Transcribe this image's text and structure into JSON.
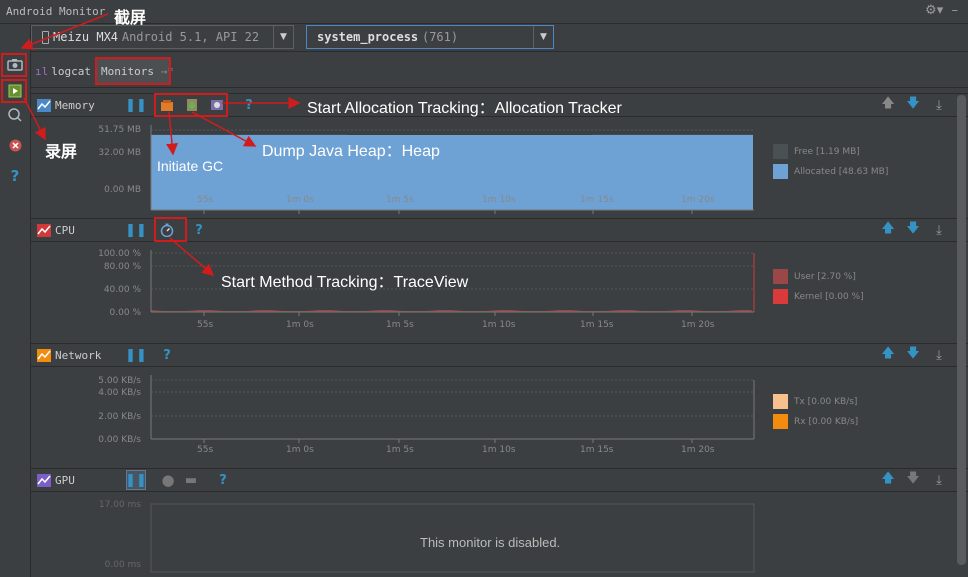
{
  "window": {
    "title": "Android Monitor"
  },
  "device": {
    "label": "Meizu MX4",
    "info": "Android 5.1, API 22"
  },
  "process": {
    "name": "system_process",
    "pid": "(761)"
  },
  "tabs": [
    {
      "label": "logcat"
    },
    {
      "label": "Monitors"
    }
  ],
  "monitors": {
    "memory": {
      "name": "Memory",
      "y_ticks": [
        "51.75 MB",
        "32.00 MB",
        "0.00 MB"
      ],
      "x_ticks": [
        "55s",
        "1m 0s",
        "1m 5s",
        "1m 10s",
        "1m 15s",
        "1m 20s"
      ],
      "legend": [
        {
          "label": "Free [1.19 MB]",
          "color": "#4a5154"
        },
        {
          "label": "Allocated [48.63 MB]",
          "color": "#6fa2d4"
        }
      ],
      "free_mb": 1.19,
      "allocated_mb": 48.63
    },
    "cpu": {
      "name": "CPU",
      "y_ticks": [
        "100.00 %",
        "80.00 %",
        "40.00 %",
        "0.00 %"
      ],
      "x_ticks": [
        "55s",
        "1m 0s",
        "1m 5s",
        "1m 10s",
        "1m 15s",
        "1m 20s"
      ],
      "legend": [
        {
          "label": "User [2.70 %]",
          "color": "#9a4747"
        },
        {
          "label": "Kernel [0.00 %]",
          "color": "#d93b3b"
        }
      ]
    },
    "network": {
      "name": "Network",
      "y_ticks": [
        "5.00 KB/s",
        "4.00 KB/s",
        "2.00 KB/s",
        "0.00 KB/s"
      ],
      "x_ticks": [
        "55s",
        "1m 0s",
        "1m 5s",
        "1m 10s",
        "1m 15s",
        "1m 20s"
      ],
      "legend": [
        {
          "label": "Tx [0.00 KB/s]",
          "color": "#f7c18f"
        },
        {
          "label": "Rx [0.00 KB/s]",
          "color": "#f28c0e"
        }
      ]
    },
    "gpu": {
      "name": "GPU",
      "y_ticks": [
        "17.00 ms",
        "0.00 ms"
      ],
      "disabled_msg": "This monitor is disabled."
    }
  },
  "annotations": {
    "screenshot": "截屏",
    "record": "录屏",
    "alloc": "Start Allocation Tracking：Allocation Tracker",
    "heap": "Dump Java Heap：Heap",
    "gc": "Initiate GC",
    "method": "Start Method Tracking：TraceView"
  },
  "colors": {
    "bg": "#3c3f41",
    "chart_bg": "#3c3f41",
    "accent": "#4a88c7",
    "annotation": "#d01c1c"
  }
}
